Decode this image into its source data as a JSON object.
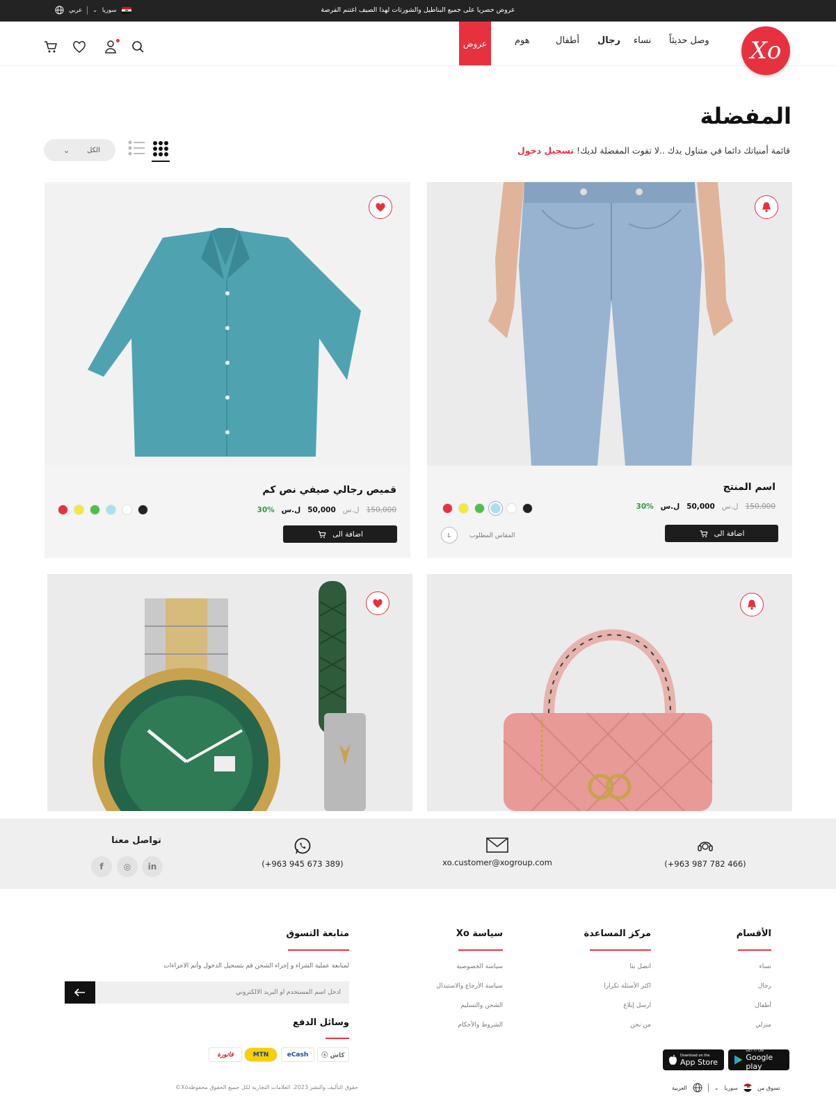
{
  "topbar": {
    "promo": "عروض حصريا على جميع البناطيل والشورتات لهذا الصيف   اغتنم الفرصة",
    "country": "سوريا",
    "language": "عربي"
  },
  "brand": {
    "logo_text": "Xo",
    "accent": "#e8313f"
  },
  "nav": {
    "new": "وصل حديثاً",
    "women": "نساء",
    "men": "رجال",
    "kids": "أطفال",
    "home": "هوم",
    "offers": "عروض"
  },
  "page": {
    "title": "المفضلة",
    "subtitle": "قائمة أمنياتك دائما في متناول يدك ..لا تفوت المفضلة لديك!",
    "login_link": "تسجيل دخول",
    "filter_value": "الكل"
  },
  "products": [
    {
      "name": "اسم المنتج",
      "old_price": "150,000",
      "old_currency": "ل.س",
      "price": "50,000",
      "currency": "ل.س",
      "discount": "30%",
      "colors": [
        "#e8313f",
        "#f4e935",
        "#4cc04c",
        "#a6e1ef",
        "#ffffff",
        "#222222"
      ],
      "add_label": "اضافة الى",
      "size_label": "المقاس المطلوب",
      "size_value": "L",
      "icon": "bell-icon"
    },
    {
      "name": "قميص رجالي صيفي نص كم",
      "old_price": "150,000",
      "old_currency": "ل.س",
      "price": "50,000",
      "currency": "ل.س",
      "discount": "30%",
      "colors": [
        "#e8313f",
        "#f4e935",
        "#4cc04c",
        "#a6e1ef",
        "#ffffff",
        "#222222"
      ],
      "add_label": "اضافة الى",
      "icon": "heart-icon"
    },
    {
      "icon": "bell-icon"
    },
    {
      "icon": "heart-icon"
    }
  ],
  "contact": {
    "phone": "(+963 987 782 466)",
    "email": "xo.customer@xogroup.com",
    "whatsapp": "(+963 945 673 389)",
    "social_title": "تواصل معنا",
    "social": [
      "in",
      "◎",
      "f"
    ]
  },
  "footer": {
    "categories_title": "الأقسام",
    "categories": [
      "نساء",
      "رجال",
      "أطفال",
      "منزلي"
    ],
    "help_title": "مركز  المساعدة",
    "help": [
      "اتصل بنا",
      "اكثر الأسئلة تكرارا",
      "ارسل إبلاغ",
      "من نحن"
    ],
    "policy_title": "سياسة Xo",
    "policy": [
      "سياسة الخصوصية",
      "سياسة الأرجاع والاستبدال",
      "الشحن والتسليم",
      "الشروط والأحكام"
    ],
    "tracking_title": "متابعة التسوق",
    "tracking_note": "لمتابعة عملية الشراء و إجراء الشحن  قم بتسجيل الدخول  وأتم الاجراءات",
    "tracking_placeholder": "ادخل اسم المستخدم أو البريد الالكتروني",
    "payment_title": "وسائل الدفع",
    "payments": [
      "كاش ⓢ",
      "eCash",
      "MTN",
      "فاتورة"
    ],
    "appstore_small": "Download on the",
    "appstore_big": "App Store",
    "googleplay_small": "GET IT ON",
    "googleplay_big": "Google play",
    "copyright": "حقوق التأليف والنشر 2023. العلامات التجارية لكل جميع الحقوق محفوظةXo©",
    "shop_from": "تسوق من",
    "bottom_country": "سوريا",
    "bottom_language": "العربية"
  }
}
